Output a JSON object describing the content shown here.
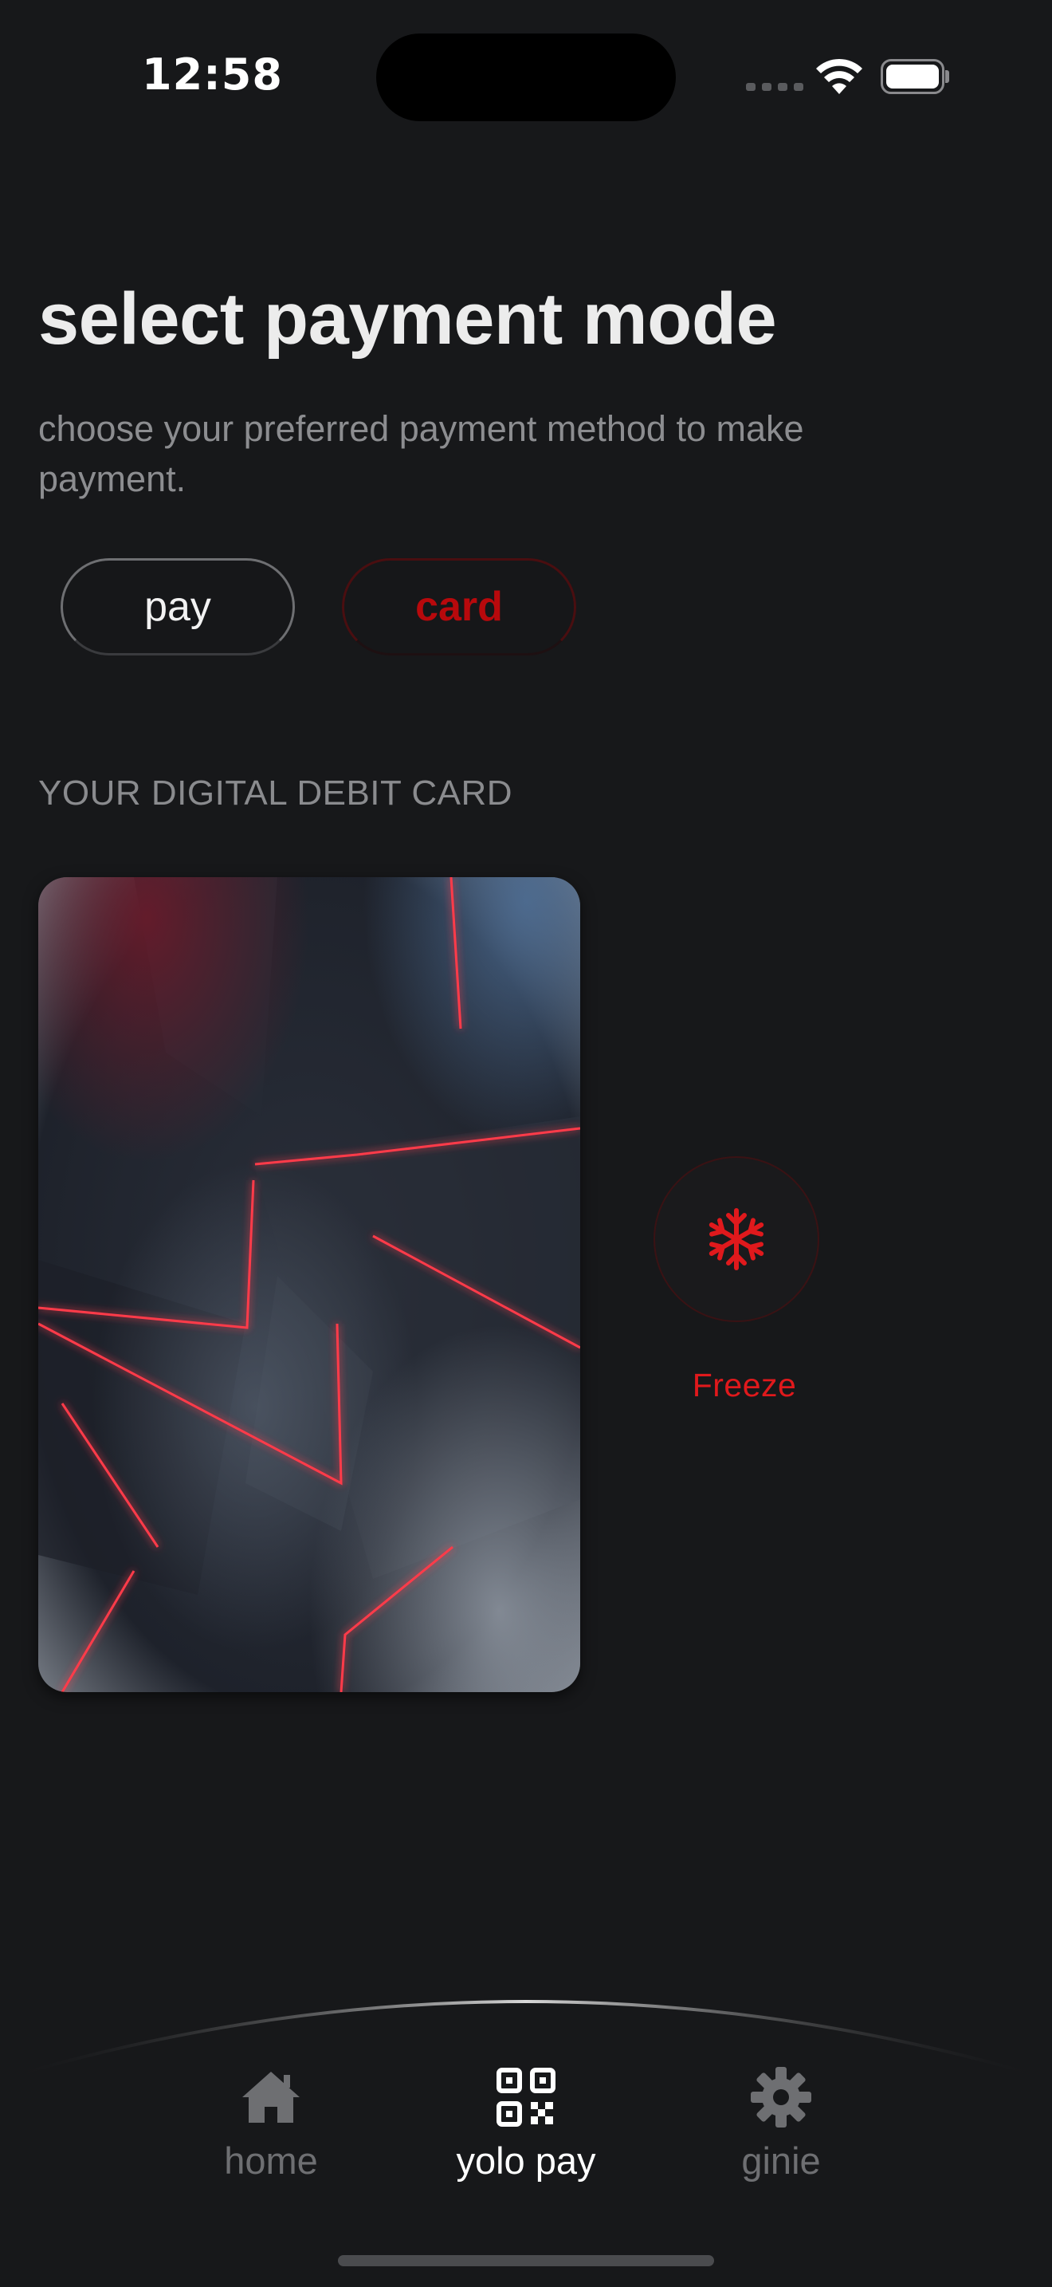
{
  "status_bar": {
    "time": "12:58",
    "icons": [
      "signal-icon",
      "wifi-icon",
      "battery-icon"
    ]
  },
  "header": {
    "title": "select payment mode",
    "subtitle": "choose your preferred payment method to make payment."
  },
  "mode_toggle": {
    "options": [
      {
        "label": "pay",
        "selected": false
      },
      {
        "label": "card",
        "selected": true
      }
    ],
    "accent_color": "#b8090c"
  },
  "card_section": {
    "label": "YOUR DIGITAL DEBIT CARD"
  },
  "freeze": {
    "icon": "snowflake-icon",
    "label": "Freeze",
    "color": "#e0191c"
  },
  "bottom_nav": {
    "items": [
      {
        "label": "home",
        "icon": "home-icon",
        "active": false
      },
      {
        "label": "yolo pay",
        "icon": "qr-code-icon",
        "active": true
      },
      {
        "label": "ginie",
        "icon": "gear-icon",
        "active": false
      }
    ]
  }
}
